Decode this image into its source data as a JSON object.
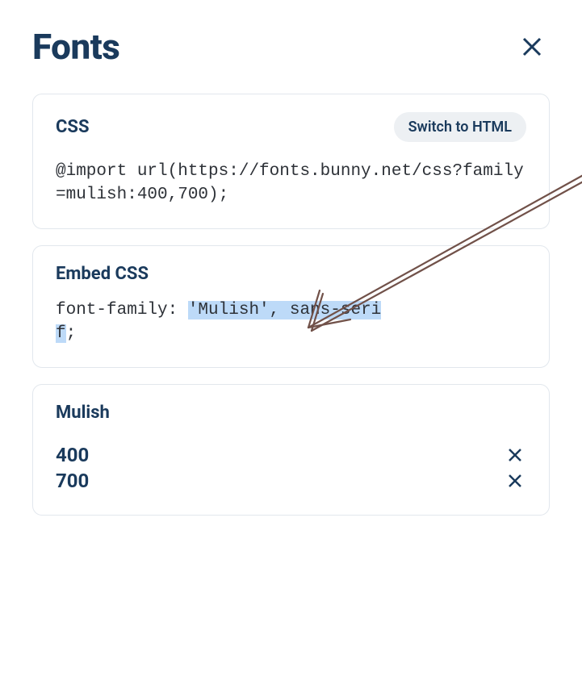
{
  "header": {
    "title": "Fonts"
  },
  "css_card": {
    "title": "CSS",
    "switch_label": "Switch to HTML",
    "code": "@import url(https://fonts.bunny.net/css?family=mulish:400,700);"
  },
  "embed_card": {
    "title": "Embed CSS",
    "prefix": "font-family: ",
    "highlight1": "'Mulish', sans-seri",
    "highlight2": "f",
    "suffix": ";"
  },
  "font_card": {
    "name": "Mulish",
    "weights": [
      "400",
      "700"
    ]
  },
  "colors": {
    "primary": "#1a3a5c",
    "border": "#e2e7ed",
    "pill_bg": "#edf0f3",
    "highlight": "#bddaf8"
  }
}
